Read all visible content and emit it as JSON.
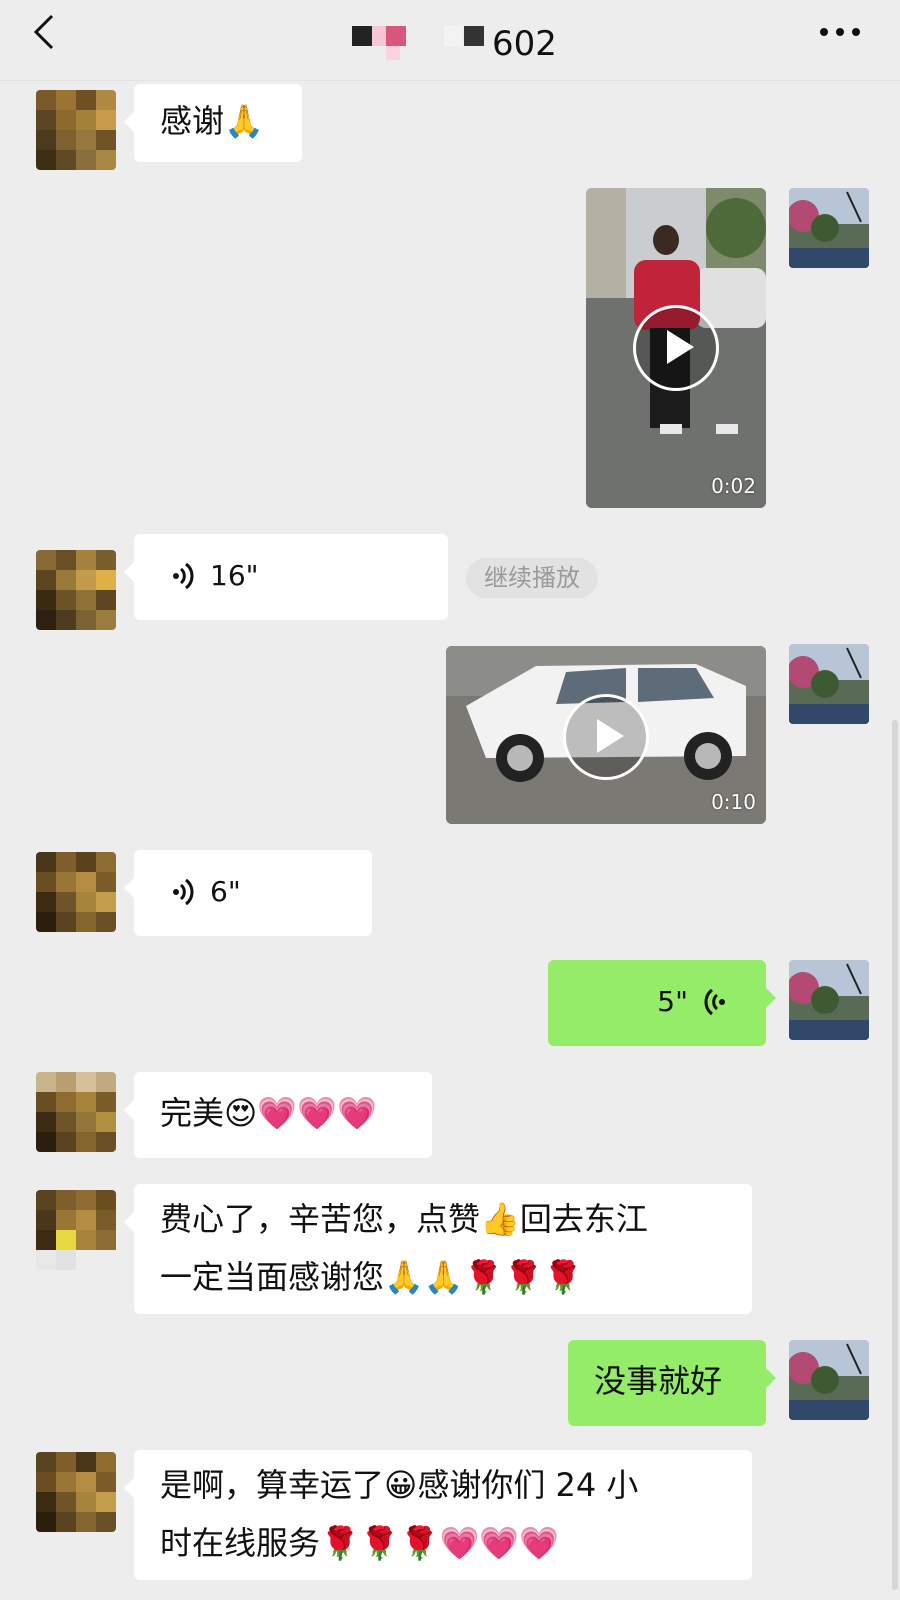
{
  "header": {
    "title_suffix": "602",
    "back_icon": "chevron-left-icon",
    "more_icon": "more-dots-icon"
  },
  "messages": {
    "m1": {
      "text": "感谢🙏"
    },
    "m2": {
      "duration": "0:02"
    },
    "m3": {
      "duration": "16\"",
      "continue_label": "继续播放"
    },
    "m4": {
      "duration": "0:10"
    },
    "m5": {
      "duration": "6\""
    },
    "m6": {
      "duration": "5\""
    },
    "m7": {
      "text": "完美😍💗💗💗"
    },
    "m8": {
      "line1": "费心了，辛苦您，点赞👍回去东江",
      "line2": "一定当面感谢您🙏🙏🌹🌹🌹"
    },
    "m9": {
      "text": "没事就好"
    },
    "m10": {
      "line1": "是啊，算幸运了😀感谢你们 24 小",
      "line2": "时在线服务🌹🌹🌹💗💗💗"
    }
  },
  "colors": {
    "background": "#ededed",
    "sent_bubble": "#95ec69",
    "received_bubble": "#ffffff"
  }
}
